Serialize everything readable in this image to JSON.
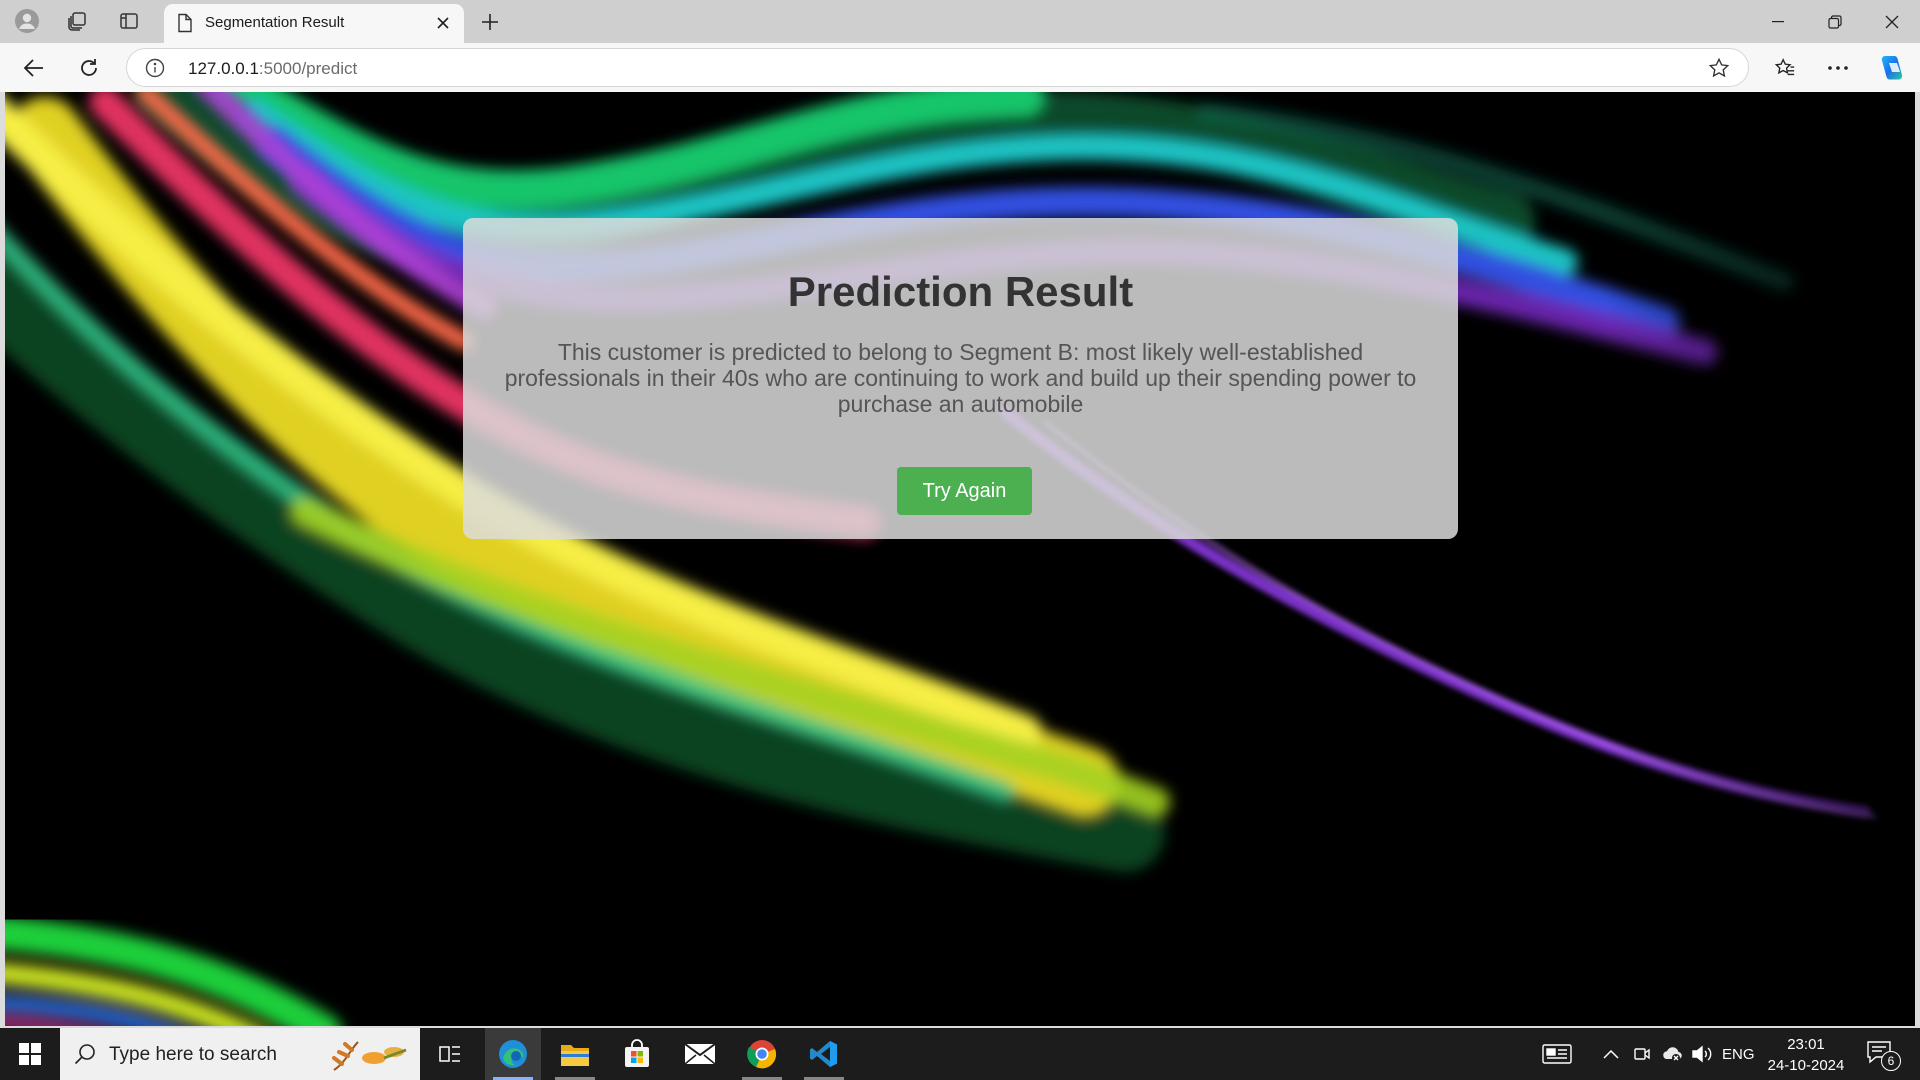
{
  "browser": {
    "tab_title": "Segmentation Result",
    "url_host": "127.0.0.1",
    "url_path": ":5000/predict"
  },
  "page": {
    "title": "Prediction Result",
    "message": "This customer is predicted to belong to Segment B: most likely well-established professionals in their 40s who are continuing to work and build up their spending power to purchase an automobile",
    "button_label": "Try Again",
    "button_color": "#4caf50"
  },
  "taskbar": {
    "search_placeholder": "Type here to search",
    "language": "ENG",
    "time": "23:01",
    "date": "24-10-2024",
    "notification_count": "6"
  },
  "icons": [
    "profile-icon",
    "workspaces-icon",
    "tab-actions-icon",
    "document-icon",
    "close-icon",
    "new-tab-icon",
    "minimize-icon",
    "restore-icon",
    "window-close-icon",
    "back-icon",
    "refresh-icon",
    "info-icon",
    "favorite-star-icon",
    "favorites-icon",
    "more-icon",
    "copilot-icon",
    "windows-start-icon",
    "search-icon",
    "task-view-icon",
    "edge-icon",
    "file-explorer-icon",
    "store-icon",
    "mail-icon",
    "chrome-icon",
    "vscode-icon",
    "news-icon",
    "chevron-up-icon",
    "meet-icon",
    "network-icon",
    "volume-icon",
    "notification-icon"
  ]
}
